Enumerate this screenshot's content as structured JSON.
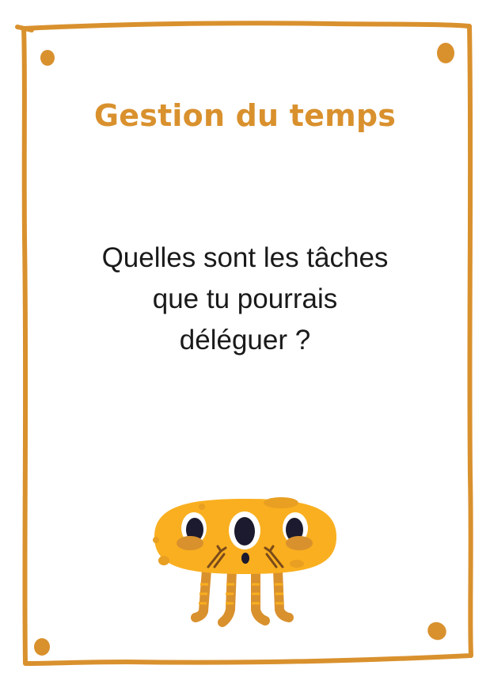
{
  "card": {
    "title": "Gestion du temps",
    "question_lines": [
      "Quelles sont les tâches",
      "que tu pourrais",
      "déléguer ?"
    ]
  },
  "colors": {
    "frame": "#D9912E",
    "title": "#D9912E",
    "creature_body": "#F9AF1F",
    "creature_spots": "#D9912E",
    "eye": "#1B1A2E",
    "text": "#1a1a1a"
  },
  "illustration": {
    "name": "three-eyed-yellow-creature",
    "eyes": 3,
    "legs": 4
  }
}
